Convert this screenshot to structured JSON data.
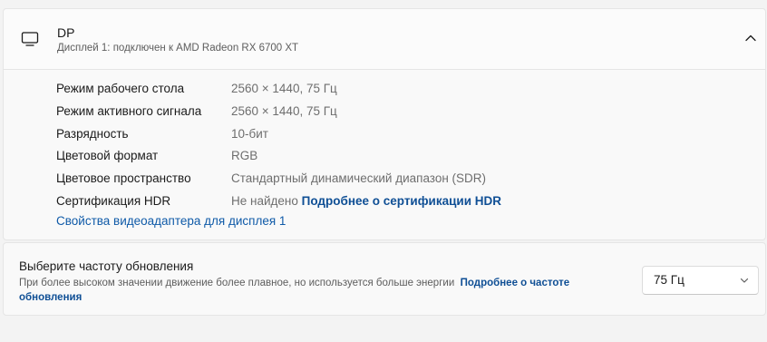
{
  "display": {
    "title": "DP",
    "subtitle": "Дисплей 1: подключен к AMD Radeon RX 6700 XT",
    "properties": [
      {
        "label": "Режим рабочего стола",
        "value": "2560 × 1440, 75 Гц"
      },
      {
        "label": "Режим активного сигнала",
        "value": "2560 × 1440, 75 Гц"
      },
      {
        "label": "Разрядность",
        "value": "10-бит"
      },
      {
        "label": "Цветовой формат",
        "value": "RGB"
      },
      {
        "label": "Цветовое пространство",
        "value": "Стандартный динамический диапазон (SDR)"
      },
      {
        "label": "Сертификация HDR",
        "value": "Не найдено",
        "link": "Подробнее о сертификации HDR"
      }
    ],
    "adapter_link": "Свойства видеоадаптера для дисплея 1"
  },
  "refresh": {
    "title": "Выберите частоту обновления",
    "description": "При более высоком значении движение более плавное, но используется больше энергии",
    "link": "Подробнее о частоте обновления",
    "selected_rate": "75 Гц"
  },
  "icons": {
    "display": "monitor-icon",
    "collapse": "chevron-up-icon",
    "dropdown": "chevron-down-icon"
  },
  "colors": {
    "link": "#0f4f95",
    "background": "#f3f3f3",
    "card": "#f9f9f9"
  }
}
